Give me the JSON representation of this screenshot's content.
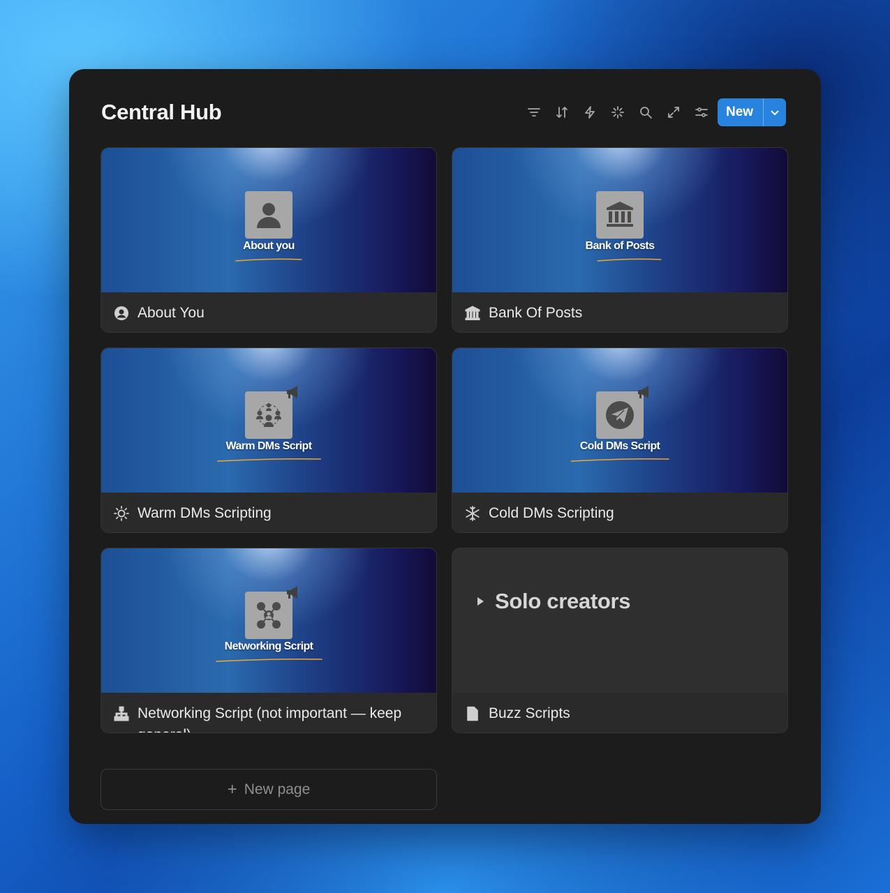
{
  "hub": {
    "title": "Central Hub",
    "toolbar": {
      "icons": [
        "filter-icon",
        "sort-icon",
        "lightning-icon",
        "sparkle-icon",
        "search-icon",
        "expand-icon",
        "settings-sliders-icon"
      ],
      "new_label": "New"
    },
    "cards": [
      {
        "cover_caption": "About you",
        "label": "About You",
        "icon": "user-circle-icon"
      },
      {
        "cover_caption": "Bank of Posts",
        "label": "Bank Of Posts",
        "icon": "bank-icon"
      },
      {
        "cover_caption": "Warm DMs Script",
        "label": "Warm DMs Scripting",
        "icon": "sun-icon"
      },
      {
        "cover_caption": "Cold DMs Script",
        "label": "Cold DMs Scripting",
        "icon": "snowflake-icon"
      },
      {
        "cover_caption": "Networking Script",
        "label": "Networking Script (not important — keep general)",
        "icon": "network-icon"
      },
      {
        "preview_heading": "Solo creators",
        "label": "Buzz Scripts",
        "icon": "document-icon"
      }
    ],
    "new_page_label": "New page"
  },
  "colors": {
    "accent": "#2783de",
    "panel": "#1c1c1c",
    "card": "#2a2a2a"
  }
}
